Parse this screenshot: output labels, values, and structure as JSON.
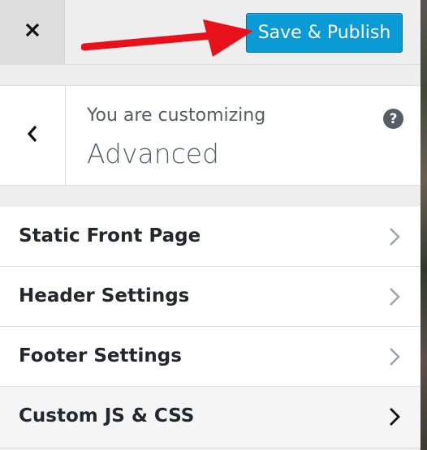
{
  "header": {
    "close_icon": "close-icon",
    "publish_label": "Save & Publish",
    "annotation": "red-arrow-pointing-to-publish",
    "colors": {
      "publish_bg": "#0a9ad6",
      "arrow": "#e8101a"
    }
  },
  "section": {
    "back_icon": "chevron-left-icon",
    "customizing_label": "You are customizing",
    "title": "Advanced",
    "help_icon": "help-icon",
    "help_glyph": "?"
  },
  "menu": {
    "items": [
      {
        "label": "Static Front Page",
        "icon": "chevron-right-icon",
        "active": false
      },
      {
        "label": "Header Settings",
        "icon": "chevron-right-icon",
        "active": false
      },
      {
        "label": "Footer Settings",
        "icon": "chevron-right-icon",
        "active": false
      },
      {
        "label": "Custom JS & CSS",
        "icon": "chevron-right-icon",
        "active": true
      }
    ]
  }
}
